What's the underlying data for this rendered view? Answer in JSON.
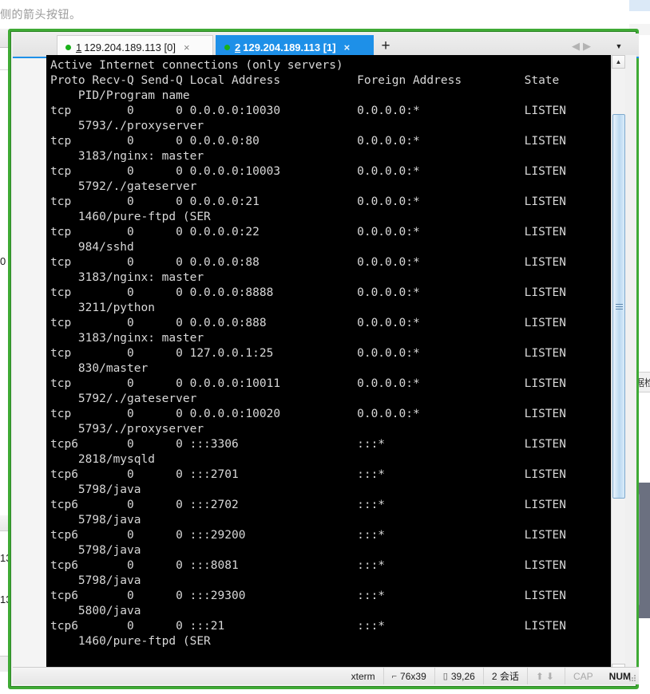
{
  "background": {
    "hint_text": "侧的箭头按钮。",
    "side_cell_text": "数据检查",
    "left_list_values": [
      "13",
      "13"
    ],
    "left_partial_number": "0"
  },
  "tabbar": {
    "tabs": [
      {
        "number": "1",
        "title": "129.204.189.113 [0]",
        "active": false,
        "status_dot": "connected-dot",
        "close_label": "×"
      },
      {
        "number": "2",
        "title": "129.204.189.113 [1]",
        "active": true,
        "status_dot": "connected-dot",
        "close_label": "×"
      }
    ],
    "new_tab_label": "+",
    "nav_prev_label": "◀",
    "nav_next_label": "▶",
    "dropdown_label": "▼",
    "pin_label": "⊥",
    "close_label": "✕"
  },
  "terminal": {
    "lines": [
      "Active Internet connections (only servers)",
      "Proto Recv-Q Send-Q Local Address           Foreign Address         State",
      "    PID/Program name",
      "tcp        0      0 0.0.0.0:10030           0.0.0.0:*               LISTEN",
      "    5793/./proxyserver",
      "tcp        0      0 0.0.0.0:80              0.0.0.0:*               LISTEN",
      "    3183/nginx: master",
      "tcp        0      0 0.0.0.0:10003           0.0.0.0:*               LISTEN",
      "    5792/./gateserver",
      "tcp        0      0 0.0.0.0:21              0.0.0.0:*               LISTEN",
      "    1460/pure-ftpd (SER",
      "tcp        0      0 0.0.0.0:22              0.0.0.0:*               LISTEN",
      "    984/sshd",
      "tcp        0      0 0.0.0.0:88              0.0.0.0:*               LISTEN",
      "    3183/nginx: master",
      "tcp        0      0 0.0.0.0:8888            0.0.0.0:*               LISTEN",
      "    3211/python",
      "tcp        0      0 0.0.0.0:888             0.0.0.0:*               LISTEN",
      "    3183/nginx: master",
      "tcp        0      0 127.0.0.1:25            0.0.0.0:*               LISTEN",
      "    830/master",
      "tcp        0      0 0.0.0.0:10011           0.0.0.0:*               LISTEN",
      "    5792/./gateserver",
      "tcp        0      0 0.0.0.0:10020           0.0.0.0:*               LISTEN",
      "    5793/./proxyserver",
      "tcp6       0      0 :::3306                 :::*                    LISTEN",
      "    2818/mysqld",
      "tcp6       0      0 :::2701                 :::*                    LISTEN",
      "    5798/java",
      "tcp6       0      0 :::2702                 :::*                    LISTEN",
      "    5798/java",
      "tcp6       0      0 :::29200                :::*                    LISTEN",
      "    5798/java",
      "tcp6       0      0 :::8081                 :::*                    LISTEN",
      "    5798/java",
      "tcp6       0      0 :::29300                :::*                    LISTEN",
      "    5800/java",
      "tcp6       0      0 :::21                   :::*                    LISTEN",
      "    1460/pure-ftpd (SER"
    ],
    "scroll_up_label": "▲",
    "scroll_down_label": "▼"
  },
  "statusbar": {
    "terminal_type": "xterm",
    "size_glyph": "⌐",
    "size": "76x39",
    "cursor_glyph": "▯",
    "cursor": "39,26",
    "sessions": "2 会话",
    "up_arrow": "⬆",
    "down_arrow": "⬇",
    "caps": "CAP",
    "num": "NUM"
  },
  "colors": {
    "window_border": "#3faa35",
    "active_tab": "#1e90e8",
    "terminal_bg": "#000000",
    "terminal_fg": "#d8d8d8",
    "status_dot": "#18b018"
  }
}
